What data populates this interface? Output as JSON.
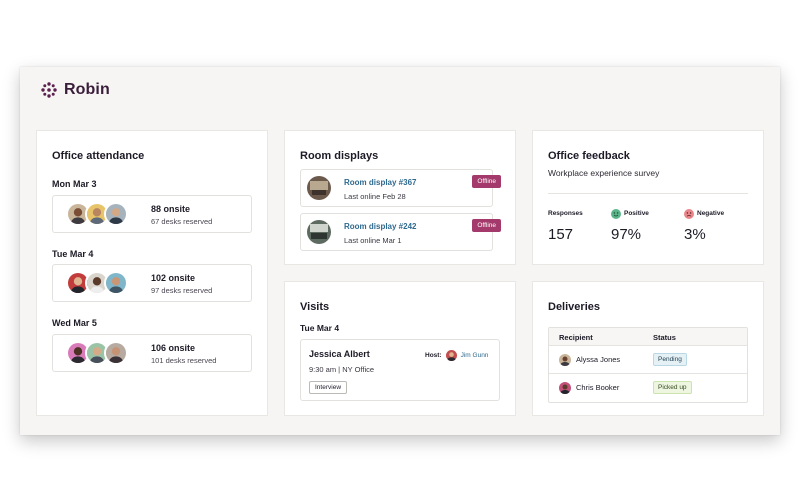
{
  "brand": {
    "name": "Robin",
    "color": "#5a1f4d"
  },
  "attendance": {
    "title": "Office attendance",
    "days": [
      {
        "day": "Mon Mar 3",
        "onsite": "88 onsite",
        "reserved": "67 desks reserved",
        "avatars": [
          "person-avatar-1",
          "person-avatar-2",
          "person-avatar-3"
        ]
      },
      {
        "day": "Tue Mar 4",
        "onsite": "102 onsite",
        "reserved": "97 desks reserved",
        "avatars": [
          "person-avatar-4",
          "person-avatar-5",
          "person-avatar-6"
        ]
      },
      {
        "day": "Wed Mar 5",
        "onsite": "106 onsite",
        "reserved": "101 desks reserved",
        "avatars": [
          "person-avatar-7",
          "person-avatar-8",
          "person-avatar-9"
        ]
      }
    ]
  },
  "rooms": {
    "title": "Room displays",
    "items": [
      {
        "name": "Room display #367",
        "last_online": "Last online Feb 28",
        "status": "Offline"
      },
      {
        "name": "Room display #242",
        "last_online": "Last online Mar 1",
        "status": "Offline"
      }
    ]
  },
  "feedback": {
    "title": "Office feedback",
    "subtitle": "Workplace experience survey",
    "responses_label": "Responses",
    "responses_value": "157",
    "positive_label": "Positive",
    "positive_value": "97%",
    "negative_label": "Negative",
    "negative_value": "3%",
    "positive_color": "#5bb58a",
    "negative_color": "#e8868b"
  },
  "visits": {
    "title": "Visits",
    "day": "Tue Mar 4",
    "visitor": "Jessica Albert",
    "host_label": "Host:",
    "host_name": "Jim Gunn",
    "time_location": "9:30 am  |  NY Office",
    "tag": "Interview"
  },
  "deliveries": {
    "title": "Deliveries",
    "col_recipient": "Recipient",
    "col_status": "Status",
    "rows": [
      {
        "recipient": "Alyssa Jones",
        "status": "Pending"
      },
      {
        "recipient": "Chris Booker",
        "status": "Picked up"
      }
    ]
  },
  "colors": {
    "offline_badge": "#a33a6b",
    "link_blue": "#2f6a8f",
    "pending_bg": "#e6f1f6",
    "picked_bg": "#eef6e2"
  }
}
